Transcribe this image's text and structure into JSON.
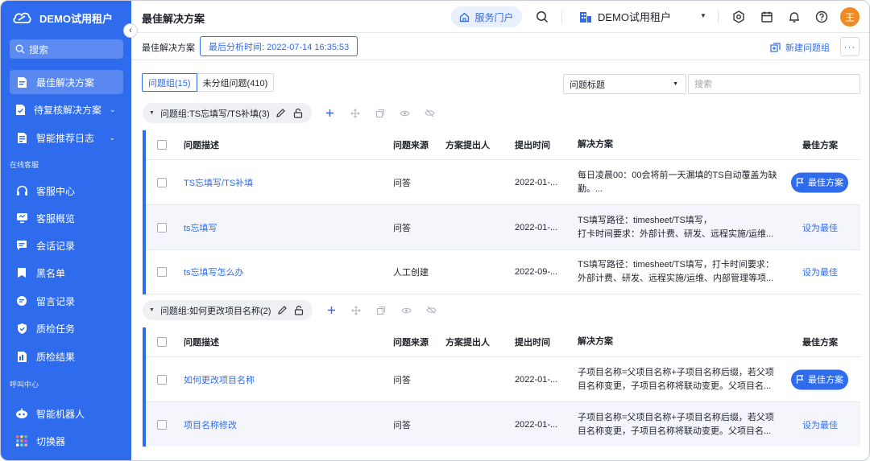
{
  "brand": {
    "name": "DEMO试用租户"
  },
  "sidebar": {
    "search_placeholder": "搜索",
    "items": [
      {
        "label": "最佳解决方案",
        "active": true
      },
      {
        "label": "待复核解决方案"
      },
      {
        "label": "智能推荐日志"
      }
    ],
    "section_online": "在线客服",
    "online_items": [
      {
        "label": "客服中心"
      },
      {
        "label": "客服概览"
      },
      {
        "label": "会话记录"
      },
      {
        "label": "黑名单"
      },
      {
        "label": "留言记录"
      },
      {
        "label": "质检任务"
      },
      {
        "label": "质检结果"
      }
    ],
    "section_call": "呼叫中心",
    "call_items": [
      {
        "label": "智能机器人"
      },
      {
        "label": "切换器"
      }
    ]
  },
  "header": {
    "title": "最佳解决方案",
    "portal_label": "服务门户",
    "tenant": "DEMO试用租户",
    "avatar_text": "王"
  },
  "subheader": {
    "label": "最佳解决方案",
    "analysis_time": "最后分析时间: 2022-07-14 16:35:53",
    "new_group": "新建问题组"
  },
  "filters": {
    "tab_groups": "问题组(15)",
    "tab_ungrouped": "未分组问题(410)",
    "field": "问题标题",
    "search_placeholder": "搜索"
  },
  "columns": {
    "desc": "问题描述",
    "source": "问题来源",
    "proposer": "方案提出人",
    "time": "提出时间",
    "solution": "解决方案",
    "best": "最佳方案"
  },
  "labels": {
    "best": "最佳方案",
    "set_best": "设为最佳"
  },
  "groups": [
    {
      "title": "问题组:TS忘填写/TS补填(3)",
      "rows": [
        {
          "desc": "TS忘填写/TS补填",
          "source": "问答",
          "time": "2022-01-...",
          "solution": "每日凌晨00：00会将前一天漏填的TS自动覆盖为缺勤。...",
          "best": true
        },
        {
          "desc": "ts忘填写",
          "source": "问答",
          "time": "2022-01-...",
          "solution": "TS填写路径：timesheet/TS填写，\n打卡时间要求：外部计费、研发、远程实施/运维...",
          "best": false
        },
        {
          "desc": "ts忘填写怎么办",
          "source": "人工创建",
          "time": "2022-09-...",
          "solution": "TS填写路径：timesheet/TS填写，打卡时间要求：外部计费、研发、远程实施/运维、内部管理等项...",
          "best": false
        }
      ]
    },
    {
      "title": "问题组:如何更改项目名称(2)",
      "rows": [
        {
          "desc": "如何更改项目名称",
          "source": "问答",
          "time": "2022-01-...",
          "solution": "子项目名称=父项目名称+子项目名称后缀，若父项目名称变更，子项目名称将联动变更。父项目名...",
          "best": true
        },
        {
          "desc": "项目名称修改",
          "source": "问答",
          "time": "2022-01-...",
          "solution": "子项目名称=父项目名称+子项目名称后缀，若父项目名称变更，子项目名称将联动变更。父项目名...",
          "best": false
        }
      ]
    }
  ],
  "colors": {
    "accent": "#2f6bed",
    "avatar": "#f08a24"
  }
}
